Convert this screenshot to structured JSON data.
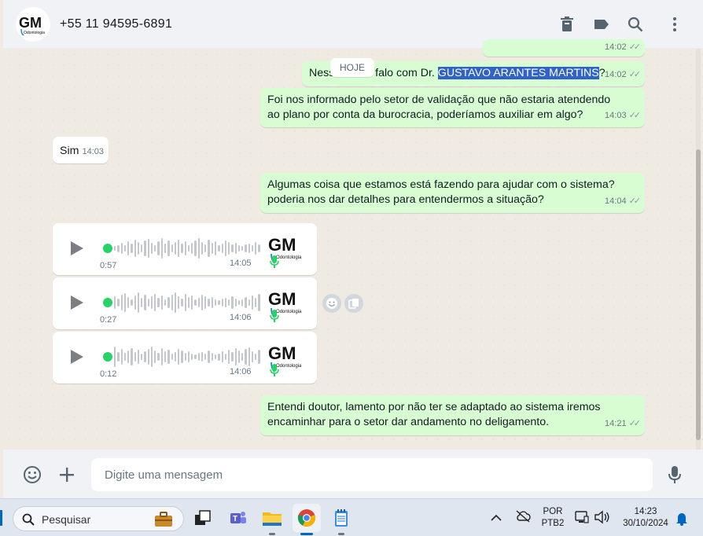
{
  "header": {
    "contact_name": "+55 11 94595-6891",
    "logo_text": "GM",
    "logo_sub": "Odontologia"
  },
  "chat": {
    "date_chip": "HOJE",
    "partial_bubble_time": "14:02",
    "messages": [
      {
        "direction": "out",
        "text_before": "Ness",
        "text_after_chip": "o falo com Dr. ",
        "highlight": "GUSTAVO ARANTES MARTINS",
        "text_end": "?",
        "time": "14:02",
        "status": "read"
      },
      {
        "direction": "out",
        "text": "Foi nos informado pelo setor de validação que não estaria atendendo ao plano por conta da burocracia, poderíamos auxiliar em algo?",
        "time": "14:03",
        "status": "read"
      },
      {
        "direction": "in",
        "text": "Sim",
        "time": "14:03"
      },
      {
        "direction": "out",
        "text": "Algumas coisa que estamos está fazendo para ajudar com o sistema? poderia nos dar detalhes para entendermos a situação?",
        "time": "14:04",
        "status": "read"
      },
      {
        "direction": "out",
        "text": "Entendi doutor, lamento por não ter se adaptado ao sistema iremos encaminhar para o setor dar andamento no deligamento.",
        "time": "14:21",
        "status": "read"
      }
    ],
    "voice_messages": [
      {
        "duration": "0:57",
        "time": "14:05"
      },
      {
        "duration": "0:27",
        "time": "14:06"
      },
      {
        "duration": "0:12",
        "time": "14:06"
      }
    ]
  },
  "footer": {
    "placeholder": "Digite uma mensagem"
  },
  "taskbar": {
    "search_placeholder": "Pesquisar",
    "language_line1": "POR",
    "language_line2": "PTB2",
    "clock_time": "14:23",
    "clock_date": "30/10/2024"
  },
  "colors": {
    "outgoing_bubble": "#d9fdd3",
    "incoming_bubble": "#ffffff",
    "accent_green": "#25d366",
    "highlight": "#3063c9"
  },
  "icons": [
    "delete-icon",
    "label-icon",
    "search-icon",
    "more-vertical-icon",
    "emoji-icon",
    "plus-icon",
    "mic-icon",
    "play-icon",
    "windows-search-icon"
  ]
}
